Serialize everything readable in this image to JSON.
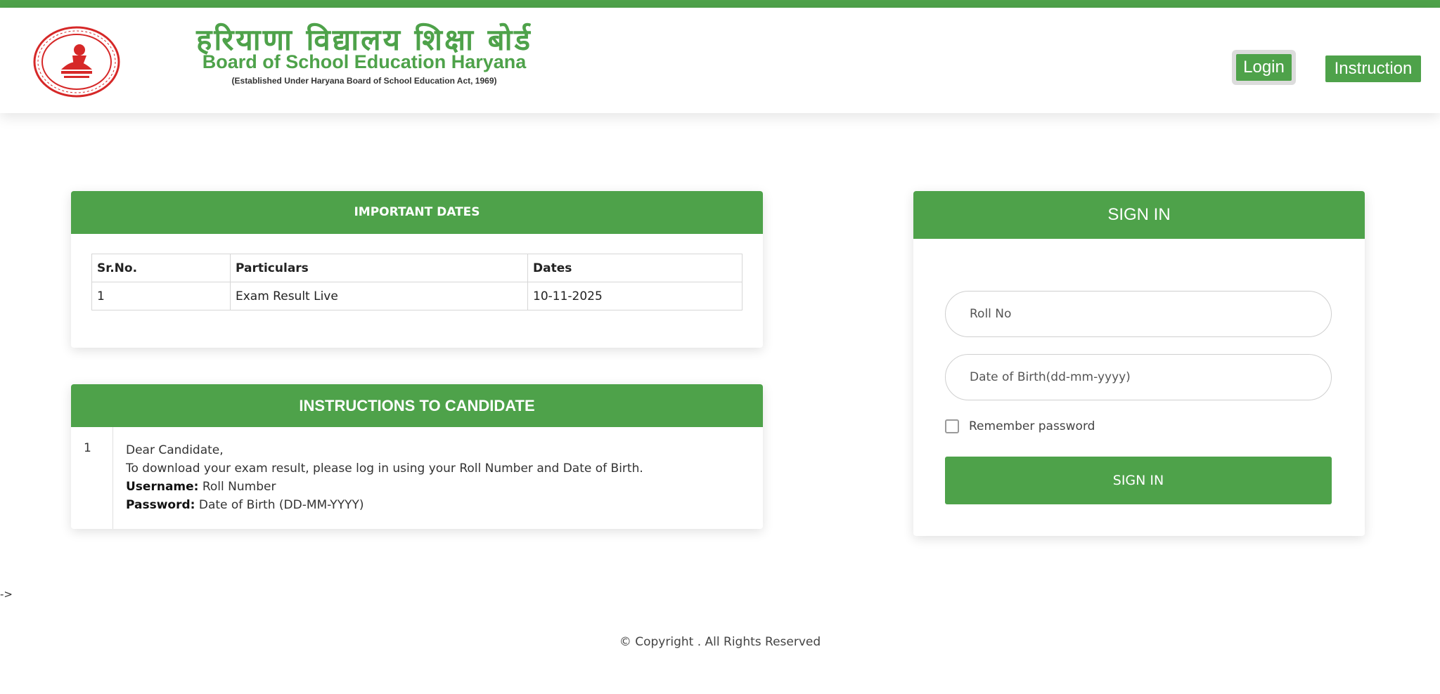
{
  "header": {
    "title_hindi": "हरियाणा विद्यालय शिक्षा बोर्ड",
    "title_english": "Board of School Education Haryana",
    "established": "(Established Under Haryana Board of School Education Act, 1969)",
    "nav": {
      "login": "Login",
      "instruction": "Instruction"
    },
    "seal_icon": "board-seal-icon"
  },
  "important_dates": {
    "title": "IMPORTANT DATES",
    "columns": [
      "Sr.No.",
      "Particulars",
      "Dates"
    ],
    "rows": [
      [
        "1",
        "Exam Result Live",
        "10-11-2025"
      ]
    ]
  },
  "instructions": {
    "title": "INSTRUCTIONS TO CANDIDATE",
    "items": [
      {
        "number": "1",
        "greeting": "Dear Candidate,",
        "line": "To download your exam result, please log in using your Roll Number and Date of Birth.",
        "username_label": "Username:",
        "username_value": "Roll Number",
        "password_label": "Password:",
        "password_value": "Date of Birth (DD-MM-YYYY)"
      }
    ]
  },
  "signin": {
    "title": "SIGN IN",
    "roll_placeholder": "Roll No",
    "dob_placeholder": "Date of Birth(dd-mm-yyyy)",
    "remember_label": "Remember password",
    "button_label": "SIGN IN"
  },
  "stray_text": "->",
  "footer": {
    "copyright": "© Copyright . All Rights Reserved"
  },
  "colors": {
    "brand_green": "#4ea24a",
    "seal_red": "#d62828"
  }
}
